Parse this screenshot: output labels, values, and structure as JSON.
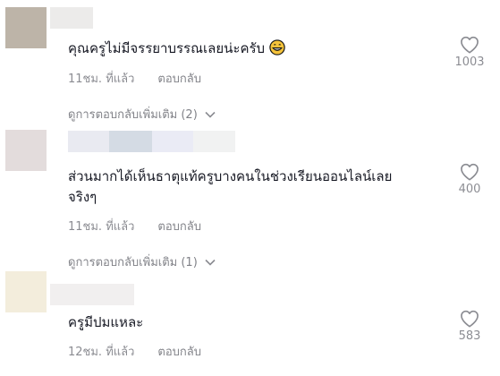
{
  "colors": {
    "text": "#161823",
    "muted": "rgba(22,24,35,0.5)",
    "like_outline": "#8a8b91",
    "emoji": "#f5c33b"
  },
  "comments": [
    {
      "text": "คุณครูไม่มีจรรยาบรรณเลยน่ะครับ",
      "emoji": "grinning-face",
      "time": "11ชม. ที่แล้ว",
      "reply_label": "ตอบกลับ",
      "view_more": "ดูการตอบกลับเพิ่มเติม (2)",
      "likes": "1003",
      "avatar_color": "#bdb4a8"
    },
    {
      "text": "ส่วนมากได้เห็นธาตุแท้ครูบางคนในช่วงเรียนออนไลน์เลย\nจริงๆ",
      "emoji": "",
      "time": "11ชม. ที่แล้ว",
      "reply_label": "ตอบกลับ",
      "view_more": "ดูการตอบกลับเพิ่มเติม (1)",
      "likes": "400",
      "avatar_color": "#e3dcdc"
    },
    {
      "text": "ครูมีปมแหละ",
      "emoji": "",
      "time": "12ชม. ที่แล้ว",
      "reply_label": "ตอบกลับ",
      "view_more": "",
      "likes": "583",
      "avatar_color": "#f3eddc"
    }
  ]
}
